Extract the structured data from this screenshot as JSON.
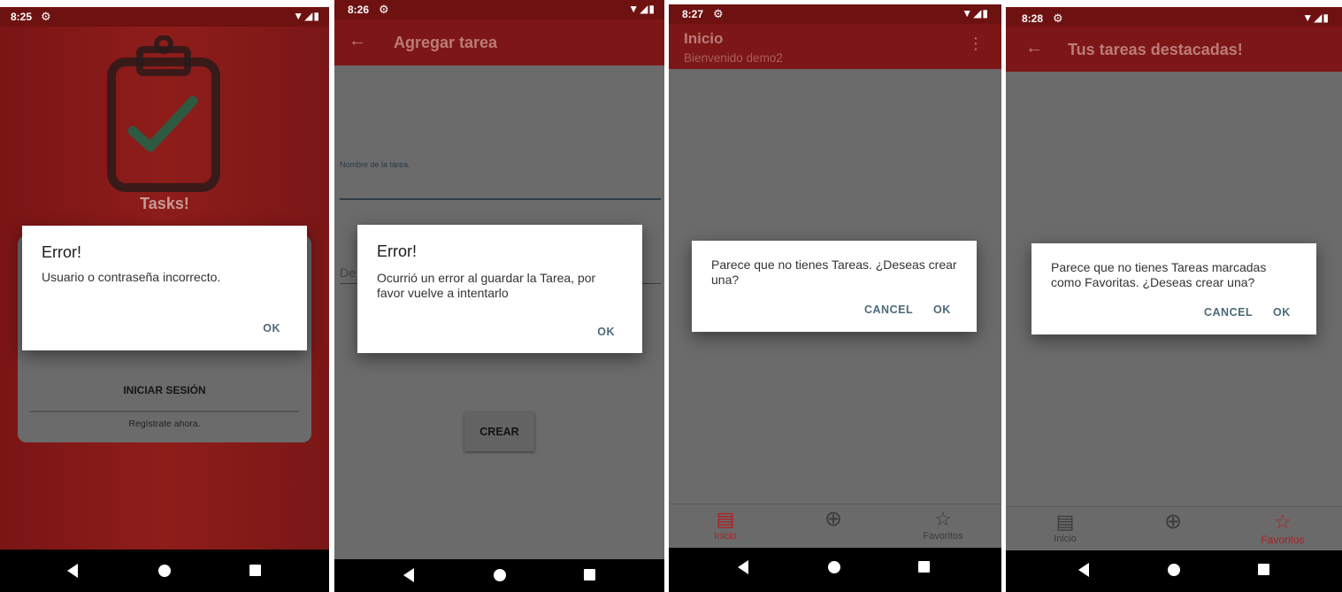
{
  "colors": {
    "red": "#c62828",
    "dialog_btn": "#4b6a78",
    "dim_grey": "#6b6b6b"
  },
  "screen1": {
    "time": "8:25",
    "app_name": "Tasks!",
    "login_button": "INICIAR SESIÓN",
    "register_link": "Regístrate ahora.",
    "dialog": {
      "title": "Error!",
      "message": "Usuario o contraseña incorrecto.",
      "ok": "OK"
    }
  },
  "screen2": {
    "time": "8:26",
    "title": "Agregar tarea",
    "task_name_label": "Nombre de la tarea.",
    "description_label": "De",
    "create_button": "CREAR",
    "dialog": {
      "title": "Error!",
      "message": "Ocurrió un error al guardar la Tarea, por favor vuelve a intentarlo",
      "ok": "OK"
    }
  },
  "screen3": {
    "time": "8:27",
    "title": "Inicio",
    "subtitle": "Bienvenido demo2",
    "dialog": {
      "message": "Parece que no tienes Tareas. ¿Deseas crear una?",
      "cancel": "CANCEL",
      "ok": "OK"
    },
    "bottom_nav": {
      "home": "Inicio",
      "favorites": "Favoritos"
    }
  },
  "screen4": {
    "time": "8:28",
    "title": "Tus tareas destacadas!",
    "dialog": {
      "message": "Parece que no tienes Tareas marcadas como Favoritas. ¿Deseas crear una?",
      "cancel": "CANCEL",
      "ok": "OK"
    },
    "bottom_nav": {
      "home": "Inicio",
      "favorites": "Favoritos"
    }
  }
}
